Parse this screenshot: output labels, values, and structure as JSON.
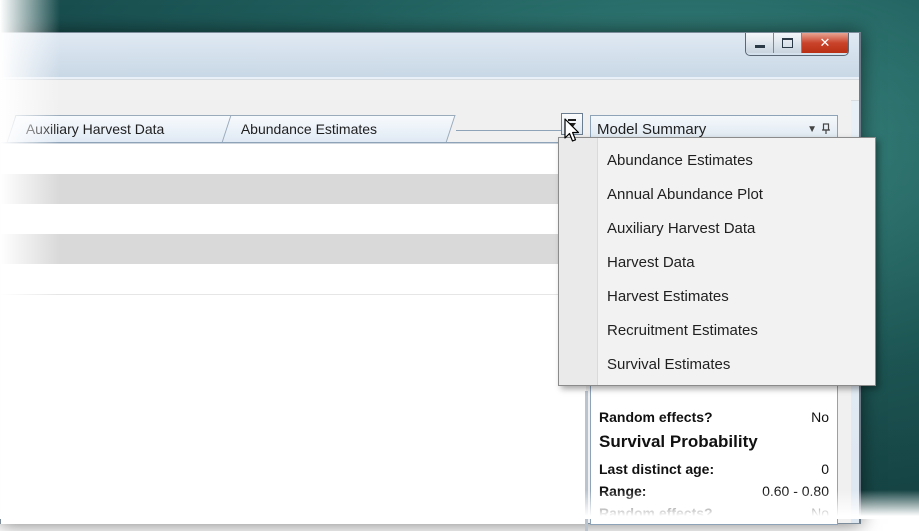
{
  "tabs": [
    {
      "label": "Auxiliary Harvest Data"
    },
    {
      "label": "Abundance Estimates"
    }
  ],
  "side_panel": {
    "title": "Model Summary",
    "chevron_icon": "chevron-down-icon",
    "pin_icon": "pin-icon",
    "rows_top": [
      {
        "label": "Random effects?",
        "value": "No"
      }
    ],
    "section_title": "Survival Probability",
    "rows": [
      {
        "label": "Last distinct age:",
        "value": "0"
      },
      {
        "label": "Range:",
        "value": "0.60 - 0.80"
      },
      {
        "label": "Random effects?",
        "value": "No"
      }
    ]
  },
  "dropdown_menu": {
    "items": [
      {
        "label": "Abundance Estimates"
      },
      {
        "label": "Annual Abundance Plot"
      },
      {
        "label": "Auxiliary Harvest Data"
      },
      {
        "label": "Harvest Data"
      },
      {
        "label": "Harvest Estimates"
      },
      {
        "label": "Recruitment Estimates"
      },
      {
        "label": "Survival Estimates"
      }
    ]
  },
  "window_buttons": {
    "minimize_icon": "minimize-icon",
    "maximize_icon": "maximize-icon",
    "close_icon": "close-icon"
  },
  "colors": {
    "desktop": "#1f5e5c",
    "close_button": "#c9422a",
    "tab_background": "#dfe9f4"
  }
}
